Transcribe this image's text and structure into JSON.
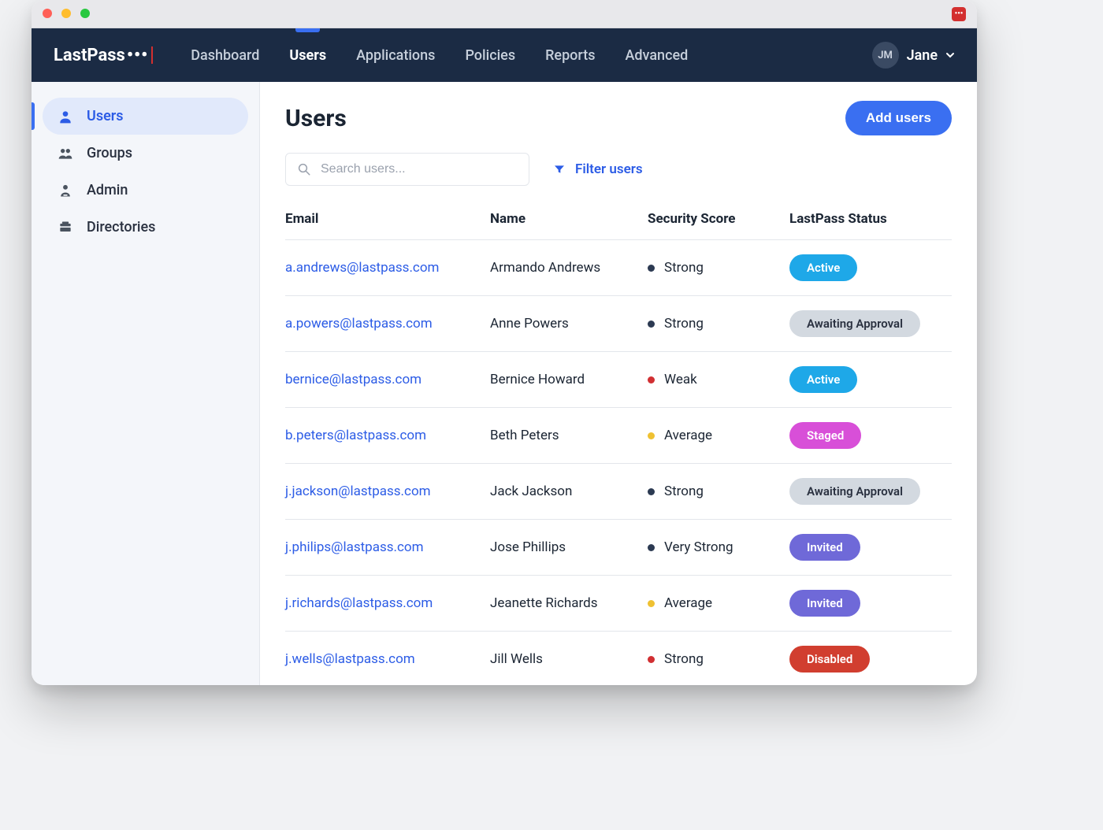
{
  "nav": {
    "logo_text": "LastPass",
    "items": [
      {
        "label": "Dashboard",
        "active": false
      },
      {
        "label": "Users",
        "active": true
      },
      {
        "label": "Applications",
        "active": false
      },
      {
        "label": "Policies",
        "active": false
      },
      {
        "label": "Reports",
        "active": false
      },
      {
        "label": "Advanced",
        "active": false
      }
    ],
    "user": {
      "initials": "JM",
      "name": "Jane"
    }
  },
  "sidebar": {
    "items": [
      {
        "label": "Users",
        "icon": "user-icon",
        "active": true
      },
      {
        "label": "Groups",
        "icon": "groups-icon",
        "active": false
      },
      {
        "label": "Admin",
        "icon": "admin-icon",
        "active": false
      },
      {
        "label": "Directories",
        "icon": "directory-icon",
        "active": false
      }
    ]
  },
  "page": {
    "title": "Users",
    "add_button": "Add users",
    "search_placeholder": "Search users...",
    "filter_label": "Filter users",
    "columns": [
      "Email",
      "Name",
      "Security Score",
      "LastPass Status"
    ]
  },
  "users": [
    {
      "email": "a.andrews@lastpass.com",
      "name": "Armando Andrews",
      "score": "Strong",
      "score_level": "strong",
      "status": "Active",
      "status_kind": "active"
    },
    {
      "email": "a.powers@lastpass.com",
      "name": "Anne Powers",
      "score": "Strong",
      "score_level": "strong",
      "status": "Awaiting Approval",
      "status_kind": "await"
    },
    {
      "email": "bernice@lastpass.com",
      "name": "Bernice Howard",
      "score": "Weak",
      "score_level": "weak",
      "status": "Active",
      "status_kind": "active"
    },
    {
      "email": "b.peters@lastpass.com",
      "name": "Beth Peters",
      "score": "Average",
      "score_level": "average",
      "status": "Staged",
      "status_kind": "staged"
    },
    {
      "email": "j.jackson@lastpass.com",
      "name": "Jack Jackson",
      "score": "Strong",
      "score_level": "strong",
      "status": "Awaiting Approval",
      "status_kind": "await"
    },
    {
      "email": "j.philips@lastpass.com",
      "name": "Jose Phillips",
      "score": "Very Strong",
      "score_level": "strong",
      "status": "Invited",
      "status_kind": "invited"
    },
    {
      "email": "j.richards@lastpass.com",
      "name": "Jeanette Richards",
      "score": "Average",
      "score_level": "average",
      "status": "Invited",
      "status_kind": "invited"
    },
    {
      "email": "j.wells@lastpass.com",
      "name": "Jill Wells",
      "score": "Strong",
      "score_level": "weak",
      "status": "Disabled",
      "status_kind": "disabled"
    }
  ],
  "colors": {
    "score": {
      "strong": "#2c3a52",
      "weak": "#d12f32",
      "average": "#efc132"
    },
    "status": {
      "active": "#1ea8e8",
      "await": "#d3d9e0",
      "staged": "#d84fd8",
      "invited": "#6f69d8",
      "disabled": "#d13e2f"
    }
  }
}
